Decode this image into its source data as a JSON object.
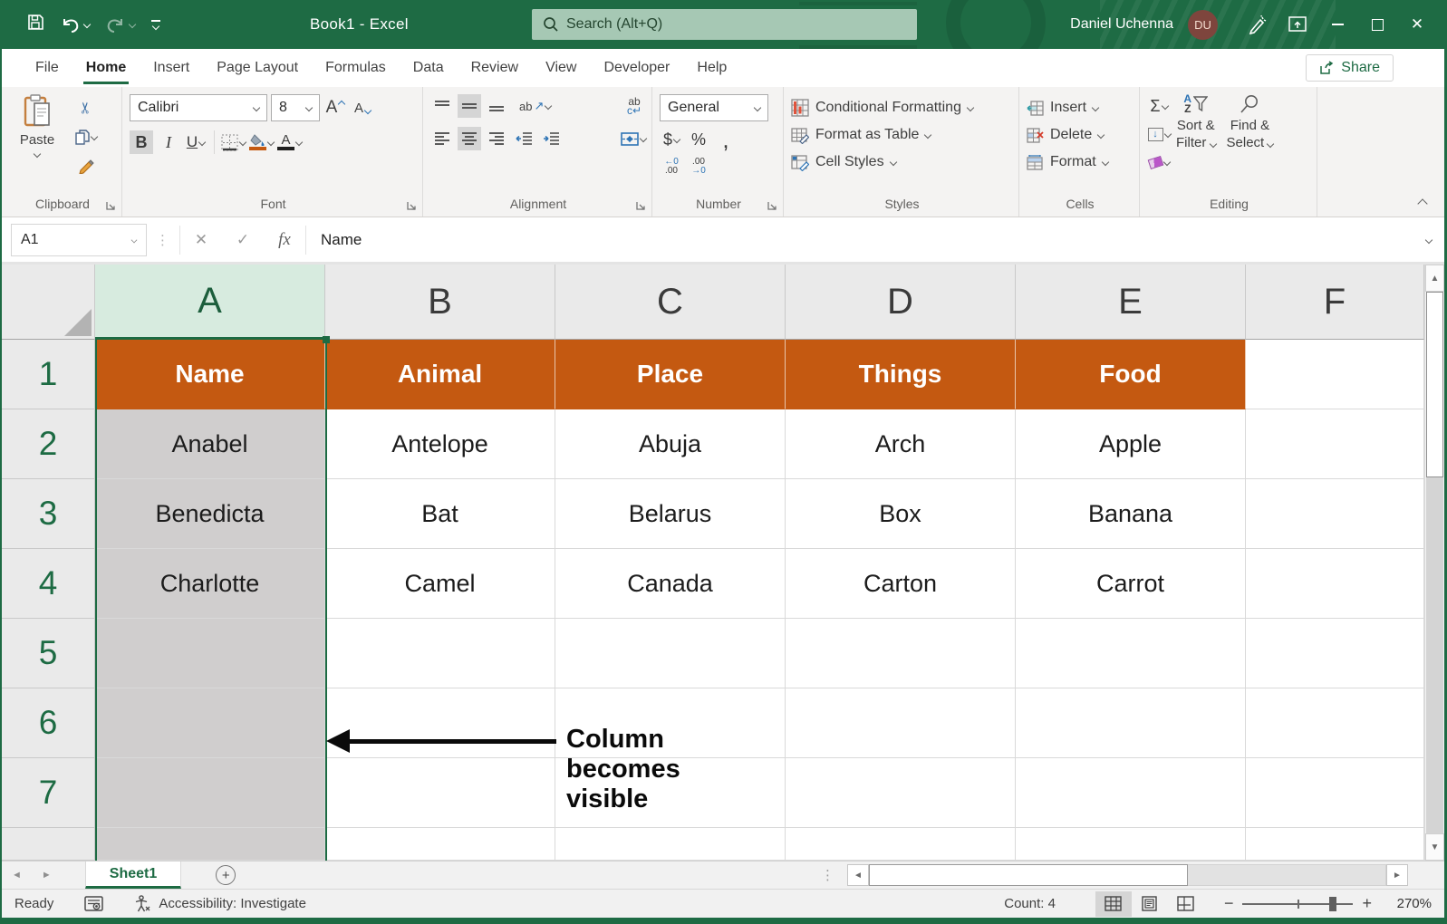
{
  "titlebar": {
    "title": "Book1  -  Excel",
    "search_placeholder": "Search (Alt+Q)",
    "user_name": "Daniel Uchenna",
    "user_initials": "DU"
  },
  "tabs": {
    "items": [
      "File",
      "Home",
      "Insert",
      "Page Layout",
      "Formulas",
      "Data",
      "Review",
      "View",
      "Developer",
      "Help"
    ],
    "active": "Home",
    "share": "Share"
  },
  "ribbon": {
    "clipboard": {
      "label": "Clipboard",
      "paste": "Paste"
    },
    "font": {
      "label": "Font",
      "family": "Calibri",
      "size": "8",
      "bold": "B",
      "italic": "I",
      "underline": "U"
    },
    "alignment": {
      "label": "Alignment"
    },
    "number": {
      "label": "Number",
      "format": "General",
      "dollar": "$",
      "percent": "%",
      "comma": ","
    },
    "styles": {
      "label": "Styles",
      "conditional_formatting": "Conditional Formatting",
      "format_as_table": "Format as Table",
      "cell_styles": "Cell Styles"
    },
    "cells": {
      "label": "Cells",
      "insert": "Insert",
      "delete": "Delete",
      "format": "Format"
    },
    "editing": {
      "label": "Editing",
      "autosum": "Σ",
      "sort_line1": "Sort &",
      "sort_line2": "Filter",
      "find_line1": "Find &",
      "find_line2": "Select",
      "sort_a": "A",
      "sort_z": "Z"
    }
  },
  "formula_bar": {
    "cell_ref": "A1",
    "fx": "fx",
    "value": "Name"
  },
  "grid": {
    "selected_column": "A",
    "col_headers": [
      "A",
      "B",
      "C",
      "D",
      "E",
      "F"
    ],
    "row_headers": [
      "1",
      "2",
      "3",
      "4",
      "5",
      "6",
      "7"
    ],
    "header_row": [
      "Name",
      "Animal",
      "Place",
      "Things",
      "Food",
      ""
    ],
    "rows": [
      [
        "Anabel",
        "Antelope",
        "Abuja",
        "Arch",
        "Apple",
        ""
      ],
      [
        "Benedicta",
        "Bat",
        "Belarus",
        "Box",
        "Banana",
        ""
      ],
      [
        "Charlotte",
        "Camel",
        "Canada",
        "Carton",
        "Carrot",
        ""
      ],
      [
        "",
        "",
        "",
        "",
        "",
        ""
      ],
      [
        "",
        "",
        "",
        "",
        "",
        ""
      ],
      [
        "",
        "",
        "",
        "",
        "",
        ""
      ]
    ],
    "annotation": "Column becomes visible"
  },
  "sheet_bar": {
    "active_tab": "Sheet1"
  },
  "status_bar": {
    "mode": "Ready",
    "accessibility": "Accessibility: Investigate",
    "count": "Count: 4",
    "zoom": "270%"
  },
  "icons": {
    "scissors": "✂",
    "check": "✓",
    "cancel": "✕",
    "close": "✕",
    "up_arrow": "▲",
    "down_arrow": "▼",
    "left_arrow": "◄",
    "right_arrow": "►",
    "dots_vertical": "⋮",
    "plus": "+",
    "minus": "−",
    "fill_down": "↓",
    "orientation_ab": "ab",
    "orientation_arrow": "↗",
    "wrap_ab": "ab",
    "wrap_c": "c↵",
    "dec_left": "←0",
    "dec_00": ".00",
    "dec_right": "→0"
  },
  "colors": {
    "excel_green": "#1E6B44",
    "header_fill": "#C45911",
    "selection_grey": "#D0CECE",
    "selected_header_fill": "#D7EBDF"
  }
}
